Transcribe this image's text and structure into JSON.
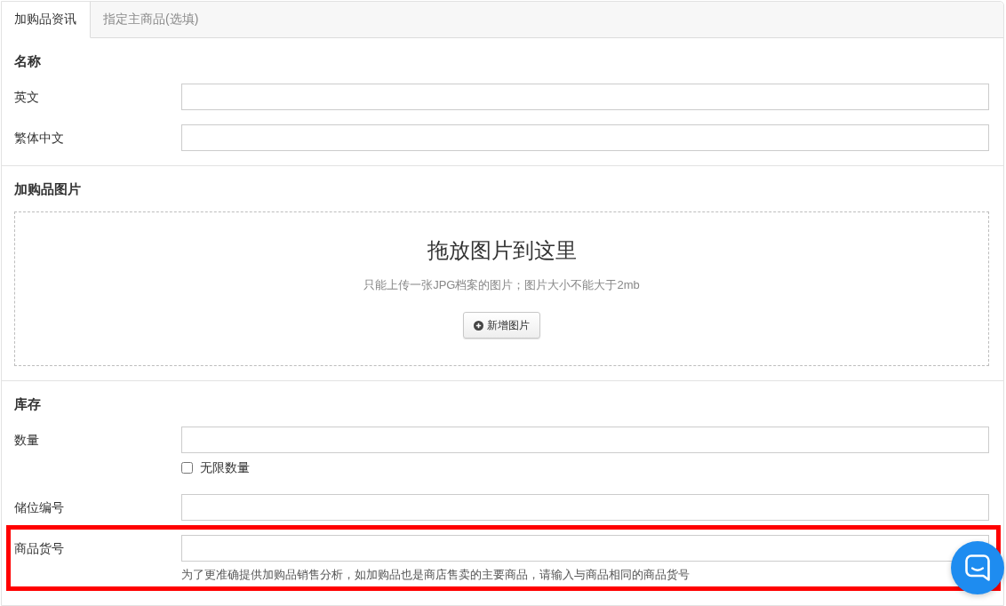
{
  "tabs": [
    {
      "label": "加购品资讯",
      "selected": true
    },
    {
      "label": "指定主商品(选填)",
      "selected": false
    }
  ],
  "sections": [
    {
      "kind": "fields",
      "title": "名称",
      "fields": [
        {
          "label": "英文",
          "highlighted": false
        },
        {
          "label": "繁体中文",
          "highlighted": false
        }
      ]
    },
    {
      "kind": "dropzone",
      "title": "加购品图片",
      "dropzone": {
        "title": "拖放图片到这里",
        "hint": "只能上传一张JPG档案的图片；图片大小不能大于2mb",
        "button": "新增图片"
      }
    },
    {
      "kind": "fields",
      "title": "库存",
      "fields": [
        {
          "label": "数量",
          "highlighted": false,
          "checkbox": {
            "label": "无限数量",
            "checked": false
          }
        },
        {
          "label": "储位编号",
          "highlighted": false
        },
        {
          "label": "商品货号",
          "highlighted": true,
          "help": "为了更准确提供加购品销售分析，如加购品也是商店售卖的主要商品，请输入与商品相同的商品货号"
        }
      ]
    }
  ]
}
